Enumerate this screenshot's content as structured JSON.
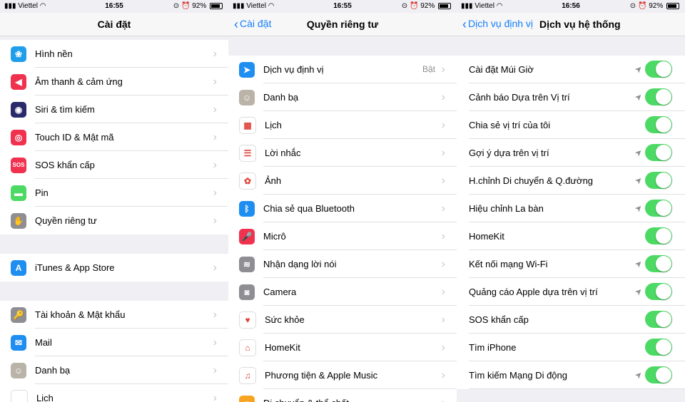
{
  "status": {
    "carrier": "Viettel",
    "battery": "92%",
    "time_1": "16:55",
    "time_2": "16:55",
    "time_3": "16:56"
  },
  "panel1": {
    "title": "Cài đặt",
    "group1": [
      {
        "label": "Hình nền",
        "icon": "wallpaper-icon",
        "color": "#1f9ee9",
        "glyph": "❀"
      },
      {
        "label": "Âm thanh & cảm ứng",
        "icon": "sound-icon",
        "color": "#f0324f",
        "glyph": "◀"
      },
      {
        "label": "Siri & tìm kiếm",
        "icon": "siri-icon",
        "color": "#2a2a6a",
        "glyph": "◉"
      },
      {
        "label": "Touch ID & Mật mã",
        "icon": "fingerprint-icon",
        "color": "#f0324f",
        "glyph": "◎"
      },
      {
        "label": "SOS khẩn cấp",
        "icon": "sos-icon",
        "color": "#f0324f",
        "glyph": "SOS"
      },
      {
        "label": "Pin",
        "icon": "battery-icon",
        "color": "#4cd964",
        "glyph": "▬"
      },
      {
        "label": "Quyền riêng tư",
        "icon": "hand-icon",
        "color": "#8e8e93",
        "glyph": "✋"
      }
    ],
    "group2": [
      {
        "label": "iTunes & App Store",
        "icon": "app-store-icon",
        "color": "#1f8ef1",
        "glyph": "A"
      }
    ],
    "group3": [
      {
        "label": "Tài khoản & Mật khẩu",
        "icon": "key-icon",
        "color": "#8e8e93",
        "glyph": "🔑"
      },
      {
        "label": "Mail",
        "icon": "mail-icon",
        "color": "#1f8ef1",
        "glyph": "✉"
      },
      {
        "label": "Danh bạ",
        "icon": "contacts-icon",
        "color": "#b9b3a8",
        "glyph": "☺"
      },
      {
        "label": "Lịch",
        "icon": "calendar-icon",
        "color": "#ffffff",
        "glyph": ""
      }
    ]
  },
  "panel2": {
    "back": "Cài đặt",
    "title": "Quyền riêng tư",
    "items": [
      {
        "label": "Dịch vụ định vị",
        "value": "Bật",
        "icon": "location-icon",
        "color": "#1f8ef1",
        "glyph": "➤"
      },
      {
        "label": "Danh bạ",
        "value": "",
        "icon": "contacts-icon",
        "color": "#b9b3a8",
        "glyph": "☺"
      },
      {
        "label": "Lịch",
        "value": "",
        "icon": "calendar-icon",
        "color": "#ffffff",
        "glyph": "▦"
      },
      {
        "label": "Lời nhắc",
        "value": "",
        "icon": "reminders-icon",
        "color": "#ffffff",
        "glyph": "☰"
      },
      {
        "label": "Ảnh",
        "value": "",
        "icon": "photos-icon",
        "color": "#ffffff",
        "glyph": "✿"
      },
      {
        "label": "Chia sẻ qua Bluetooth",
        "value": "",
        "icon": "bluetooth-icon",
        "color": "#1f8ef1",
        "glyph": "ᛒ"
      },
      {
        "label": "Micrô",
        "value": "",
        "icon": "microphone-icon",
        "color": "#f0324f",
        "glyph": "🎤"
      },
      {
        "label": "Nhận dạng lời nói",
        "value": "",
        "icon": "speech-icon",
        "color": "#8e8e93",
        "glyph": "≋"
      },
      {
        "label": "Camera",
        "value": "",
        "icon": "camera-icon",
        "color": "#8e8e93",
        "glyph": "◙"
      },
      {
        "label": "Sức khỏe",
        "value": "",
        "icon": "health-icon",
        "color": "#ffffff",
        "glyph": "♥"
      },
      {
        "label": "HomeKit",
        "value": "",
        "icon": "home-icon",
        "color": "#ffffff",
        "glyph": "⌂"
      },
      {
        "label": "Phương tiện & Apple Music",
        "value": "",
        "icon": "music-icon",
        "color": "#ffffff",
        "glyph": "♫"
      },
      {
        "label": "Di chuyển & thể chất",
        "value": "",
        "icon": "motion-icon",
        "color": "#f7a520",
        "glyph": "≡"
      }
    ]
  },
  "panel3": {
    "back": "Dịch vụ định vị",
    "title": "Dịch vụ hệ thống",
    "items": [
      {
        "label": "Cài đặt Múi Giờ",
        "arrow": true
      },
      {
        "label": "Cảnh báo Dựa trên Vị trí",
        "arrow": true
      },
      {
        "label": "Chia sẻ vị trí của tôi",
        "arrow": false
      },
      {
        "label": "Gợi ý dựa trên vị trí",
        "arrow": true
      },
      {
        "label": "H.chỉnh Di chuyển & Q.đường",
        "arrow": true
      },
      {
        "label": "Hiệu chỉnh La bàn",
        "arrow": true
      },
      {
        "label": "HomeKit",
        "arrow": false
      },
      {
        "label": "Kết nối mạng Wi-Fi",
        "arrow": true
      },
      {
        "label": "Quảng cáo Apple dựa trên vị trí",
        "arrow": true
      },
      {
        "label": "SOS khẩn cấp",
        "arrow": false
      },
      {
        "label": "Tìm iPhone",
        "arrow": false
      },
      {
        "label": "Tìm kiếm Mạng Di động",
        "arrow": true
      }
    ]
  }
}
